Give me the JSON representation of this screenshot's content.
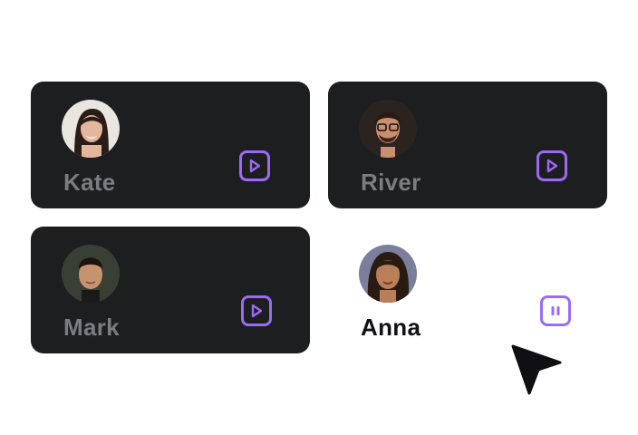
{
  "accent_color": "#9b6cf3",
  "card_color": "#1d1e20",
  "voices": [
    {
      "name": "Kate",
      "state": "idle",
      "control_icon": "play-icon",
      "avatar_icon": "woman-portrait-icon"
    },
    {
      "name": "River",
      "state": "idle",
      "control_icon": "play-icon",
      "avatar_icon": "man-portrait-icon"
    },
    {
      "name": "Mark",
      "state": "idle",
      "control_icon": "play-icon",
      "avatar_icon": "man-portrait-icon"
    },
    {
      "name": "Anna",
      "state": "playing",
      "control_icon": "pause-icon",
      "avatar_icon": "woman-portrait-icon"
    }
  ],
  "pointer_icon": "cursor-arrow-icon"
}
